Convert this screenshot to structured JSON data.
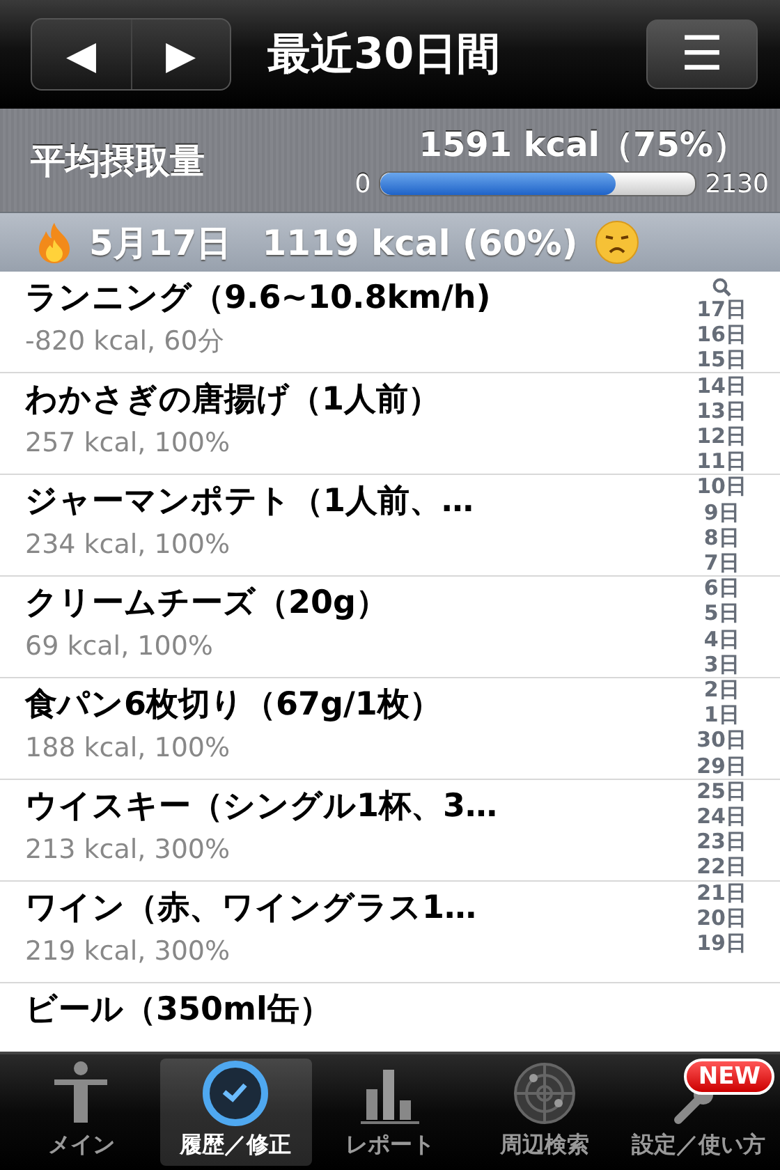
{
  "header": {
    "prev": "◀",
    "next": "▶",
    "title": "最近30日間",
    "menu": "☰"
  },
  "summary": {
    "label": "平均摂取量",
    "value": "1591 kcal（75%）",
    "min": "0",
    "max": "2130",
    "level": 0.747
  },
  "day": {
    "date": "5月17日",
    "total": "1119 kcal (60%)"
  },
  "entries": [
    {
      "name": "ランニング（9.6~10.8km/h)",
      "detail": "-820 kcal, 60分"
    },
    {
      "name": "わかさぎの唐揚げ（1人前）",
      "detail": "257 kcal, 100%"
    },
    {
      "name": "ジャーマンポテト（1人前、…",
      "detail": "234 kcal, 100%"
    },
    {
      "name": "クリームチーズ（20g）",
      "detail": "69 kcal, 100%"
    },
    {
      "name": "食パン6枚切り（67g/1枚）",
      "detail": "188 kcal, 100%"
    },
    {
      "name": "ウイスキー（シングル1杯、3…",
      "detail": "213 kcal, 300%"
    },
    {
      "name": "ワイン（赤、ワイングラス1…",
      "detail": "219 kcal, 300%"
    },
    {
      "name": "ビール（350ml缶）"
    }
  ],
  "index": [
    "17日",
    "16日",
    "15日",
    "14日",
    "13日",
    "12日",
    "11日",
    "10日",
    "9日",
    "8日",
    "7日",
    "6日",
    "5日",
    "4日",
    "3日",
    "2日",
    "1日",
    "30日",
    "29日",
    "25日",
    "24日",
    "23日",
    "22日",
    "21日",
    "20日",
    "19日"
  ],
  "tabs": [
    {
      "label": "メイン",
      "selected": false
    },
    {
      "label": "履歴／修正",
      "selected": true
    },
    {
      "label": "レポート",
      "selected": false
    },
    {
      "label": "周辺検索",
      "selected": false
    },
    {
      "label": "設定／使い方",
      "selected": false,
      "badge": "NEW"
    }
  ]
}
